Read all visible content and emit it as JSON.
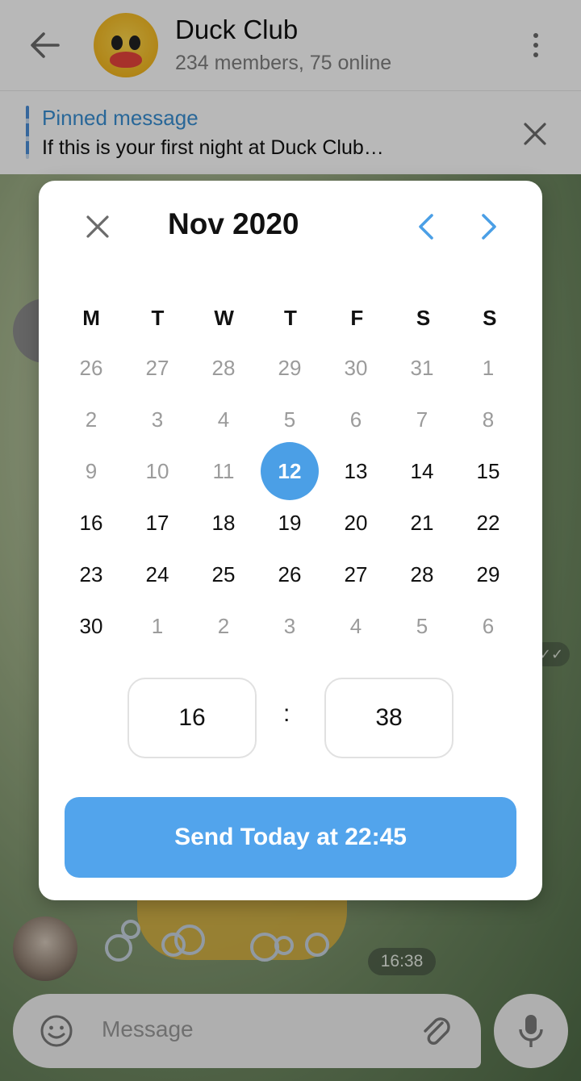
{
  "header": {
    "title": "Duck Club",
    "subtitle": "234 members, 75 online"
  },
  "pinned": {
    "title": "Pinned message",
    "text": "If this is your first night at Duck Club…"
  },
  "calendar": {
    "month_label": "Nov 2020",
    "weekdays": [
      "M",
      "T",
      "W",
      "T",
      "F",
      "S",
      "S"
    ],
    "days": [
      {
        "label": "26",
        "muted": true
      },
      {
        "label": "27",
        "muted": true
      },
      {
        "label": "28",
        "muted": true
      },
      {
        "label": "29",
        "muted": true
      },
      {
        "label": "30",
        "muted": true
      },
      {
        "label": "31",
        "muted": true
      },
      {
        "label": "1",
        "muted": true
      },
      {
        "label": "2",
        "muted": true
      },
      {
        "label": "3",
        "muted": true
      },
      {
        "label": "4",
        "muted": true
      },
      {
        "label": "5",
        "muted": true
      },
      {
        "label": "6",
        "muted": true
      },
      {
        "label": "7",
        "muted": true
      },
      {
        "label": "8",
        "muted": true
      },
      {
        "label": "9",
        "muted": true
      },
      {
        "label": "10",
        "muted": true
      },
      {
        "label": "11",
        "muted": true
      },
      {
        "label": "12",
        "selected": true
      },
      {
        "label": "13"
      },
      {
        "label": "14"
      },
      {
        "label": "15"
      },
      {
        "label": "16"
      },
      {
        "label": "17"
      },
      {
        "label": "18"
      },
      {
        "label": "19"
      },
      {
        "label": "20"
      },
      {
        "label": "21"
      },
      {
        "label": "22"
      },
      {
        "label": "23"
      },
      {
        "label": "24"
      },
      {
        "label": "25"
      },
      {
        "label": "26"
      },
      {
        "label": "27"
      },
      {
        "label": "28"
      },
      {
        "label": "29"
      },
      {
        "label": "30"
      },
      {
        "label": "1",
        "muted": true
      },
      {
        "label": "2",
        "muted": true
      },
      {
        "label": "3",
        "muted": true
      },
      {
        "label": "4",
        "muted": true
      },
      {
        "label": "5",
        "muted": true
      },
      {
        "label": "6",
        "muted": true
      }
    ],
    "hour": "16",
    "minute": "38",
    "separator": ":",
    "send_label": "Send Today at 22:45"
  },
  "chat": {
    "timestamp": "16:38",
    "input_placeholder": "Message"
  },
  "colors": {
    "accent": "#4b9fe6",
    "send_button": "#52a4ec",
    "pinned_title": "#3a8fd3"
  },
  "icons": {
    "back": "arrow-left-icon",
    "menu": "more-vertical-icon",
    "pin_close": "close-icon",
    "dialog_close": "close-icon",
    "prev": "chevron-left-icon",
    "next": "chevron-right-icon",
    "emoji": "smile-icon",
    "attach": "paperclip-icon",
    "mic": "microphone-icon"
  }
}
